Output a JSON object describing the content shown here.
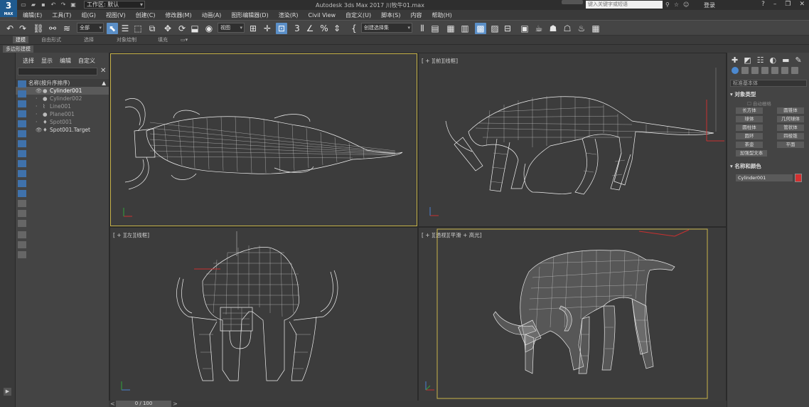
{
  "app": {
    "logo_text": "3",
    "logo_sub": "MAX",
    "window_title": "Autodesk 3ds Max 2017    川牧牛01.max",
    "workspace_label": "工作区: 默认",
    "search_placeholder": "键入关键字或短语",
    "login_label": "登录"
  },
  "menu": [
    "编辑(E)",
    "工具(T)",
    "组(G)",
    "视图(V)",
    "创建(C)",
    "修改器(M)",
    "动画(A)",
    "图形编辑器(D)",
    "渲染(R)",
    "Civil View",
    "自定义(U)",
    "脚本(S)",
    "内容",
    "帮助(H)"
  ],
  "toolbar": {
    "filter_select": "全部",
    "view_select": "视图",
    "selection_set": "创建选择集"
  },
  "ribbon": {
    "tabs": [
      "建模",
      "自由形式",
      "选择",
      "对象绘制",
      "填充"
    ],
    "active_subtab": "多边形建模"
  },
  "scene_explorer": {
    "tabs": [
      "选择",
      "显示",
      "编辑",
      "自定义"
    ],
    "column_header": "名称(按升序排序)",
    "objects": [
      {
        "name": "Cylinder001",
        "selected": true
      },
      {
        "name": "Cylinder002",
        "selected": false
      },
      {
        "name": "Line001",
        "selected": false
      },
      {
        "name": "Plane001",
        "selected": false
      },
      {
        "name": "Spot001",
        "selected": false
      },
      {
        "name": "Spot001.Target",
        "selected": false
      }
    ]
  },
  "viewports": {
    "top_left_label": "",
    "top_right_label": "[ + ][前][线框]",
    "bottom_left_label": "[ + ][左][线框]",
    "bottom_right_label": "[ + ][透视][平滑 + 高光]"
  },
  "timeline": {
    "frame_display": "0 / 100"
  },
  "command_panel": {
    "category_dropdown": "标准基本体",
    "object_type_header": "对象类型",
    "autogrid_label": "自动栅格",
    "object_buttons": [
      "长方体",
      "圆锥体",
      "球体",
      "几何球体",
      "圆柱体",
      "管状体",
      "圆环",
      "四棱锥",
      "茶壶",
      "平面",
      "加强型文本"
    ],
    "name_color_header": "名称和颜色",
    "object_name": "Cylinder001",
    "object_color": "#d33030"
  }
}
